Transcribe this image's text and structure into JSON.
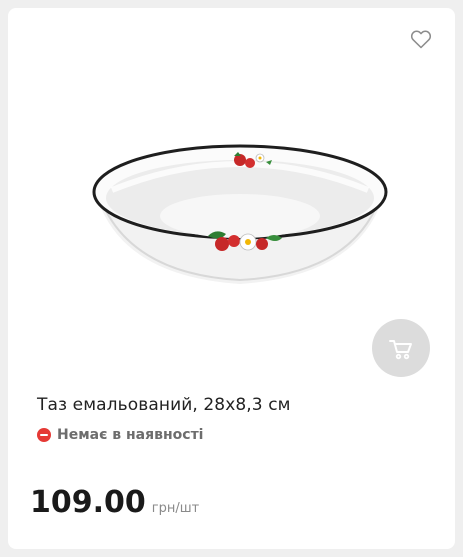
{
  "product": {
    "title": "Таз емальований, 28х8,3 см",
    "stock_status": "Немає в наявності",
    "price": "109.00",
    "price_unit": "грн/шт"
  },
  "icons": {
    "favorite": "heart-outline-icon",
    "cart": "cart-icon",
    "stock": "minus-circle-icon"
  },
  "colors": {
    "stock_status": "#e53935",
    "cart_button_bg": "#dcdcdc",
    "page_bg": "#efefef"
  }
}
